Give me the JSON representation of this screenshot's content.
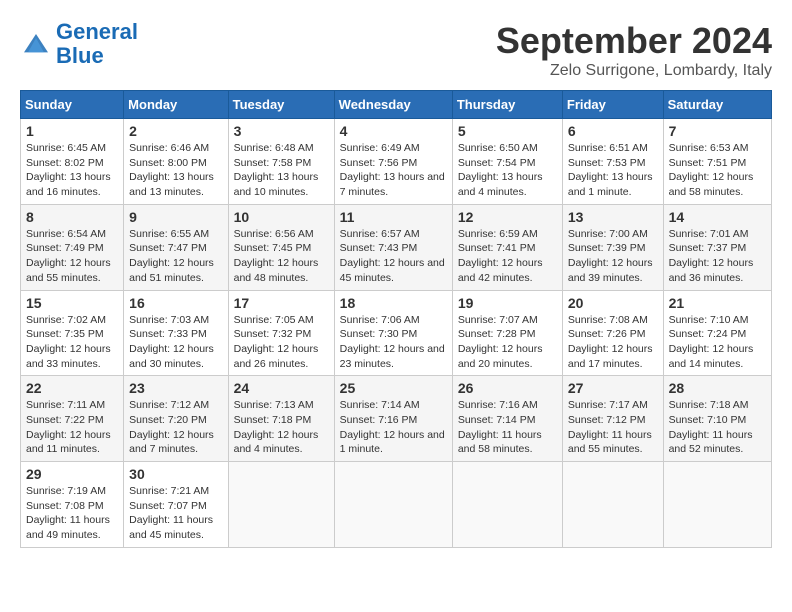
{
  "header": {
    "logo_general": "General",
    "logo_blue": "Blue",
    "title": "September 2024",
    "subtitle": "Zelo Surrigone, Lombardy, Italy"
  },
  "calendar": {
    "days_of_week": [
      "Sunday",
      "Monday",
      "Tuesday",
      "Wednesday",
      "Thursday",
      "Friday",
      "Saturday"
    ],
    "weeks": [
      [
        null,
        {
          "day": "2",
          "sunrise": "Sunrise: 6:46 AM",
          "sunset": "Sunset: 8:00 PM",
          "daylight": "Daylight: 13 hours and 13 minutes."
        },
        {
          "day": "3",
          "sunrise": "Sunrise: 6:48 AM",
          "sunset": "Sunset: 7:58 PM",
          "daylight": "Daylight: 13 hours and 10 minutes."
        },
        {
          "day": "4",
          "sunrise": "Sunrise: 6:49 AM",
          "sunset": "Sunset: 7:56 PM",
          "daylight": "Daylight: 13 hours and 7 minutes."
        },
        {
          "day": "5",
          "sunrise": "Sunrise: 6:50 AM",
          "sunset": "Sunset: 7:54 PM",
          "daylight": "Daylight: 13 hours and 4 minutes."
        },
        {
          "day": "6",
          "sunrise": "Sunrise: 6:51 AM",
          "sunset": "Sunset: 7:53 PM",
          "daylight": "Daylight: 13 hours and 1 minute."
        },
        {
          "day": "7",
          "sunrise": "Sunrise: 6:53 AM",
          "sunset": "Sunset: 7:51 PM",
          "daylight": "Daylight: 12 hours and 58 minutes."
        }
      ],
      [
        {
          "day": "1",
          "sunrise": "Sunrise: 6:45 AM",
          "sunset": "Sunset: 8:02 PM",
          "daylight": "Daylight: 13 hours and 16 minutes."
        },
        {
          "day": "9",
          "sunrise": "Sunrise: 6:55 AM",
          "sunset": "Sunset: 7:47 PM",
          "daylight": "Daylight: 12 hours and 51 minutes."
        },
        {
          "day": "10",
          "sunrise": "Sunrise: 6:56 AM",
          "sunset": "Sunset: 7:45 PM",
          "daylight": "Daylight: 12 hours and 48 minutes."
        },
        {
          "day": "11",
          "sunrise": "Sunrise: 6:57 AM",
          "sunset": "Sunset: 7:43 PM",
          "daylight": "Daylight: 12 hours and 45 minutes."
        },
        {
          "day": "12",
          "sunrise": "Sunrise: 6:59 AM",
          "sunset": "Sunset: 7:41 PM",
          "daylight": "Daylight: 12 hours and 42 minutes."
        },
        {
          "day": "13",
          "sunrise": "Sunrise: 7:00 AM",
          "sunset": "Sunset: 7:39 PM",
          "daylight": "Daylight: 12 hours and 39 minutes."
        },
        {
          "day": "14",
          "sunrise": "Sunrise: 7:01 AM",
          "sunset": "Sunset: 7:37 PM",
          "daylight": "Daylight: 12 hours and 36 minutes."
        }
      ],
      [
        {
          "day": "8",
          "sunrise": "Sunrise: 6:54 AM",
          "sunset": "Sunset: 7:49 PM",
          "daylight": "Daylight: 12 hours and 55 minutes."
        },
        {
          "day": "16",
          "sunrise": "Sunrise: 7:03 AM",
          "sunset": "Sunset: 7:33 PM",
          "daylight": "Daylight: 12 hours and 30 minutes."
        },
        {
          "day": "17",
          "sunrise": "Sunrise: 7:05 AM",
          "sunset": "Sunset: 7:32 PM",
          "daylight": "Daylight: 12 hours and 26 minutes."
        },
        {
          "day": "18",
          "sunrise": "Sunrise: 7:06 AM",
          "sunset": "Sunset: 7:30 PM",
          "daylight": "Daylight: 12 hours and 23 minutes."
        },
        {
          "day": "19",
          "sunrise": "Sunrise: 7:07 AM",
          "sunset": "Sunset: 7:28 PM",
          "daylight": "Daylight: 12 hours and 20 minutes."
        },
        {
          "day": "20",
          "sunrise": "Sunrise: 7:08 AM",
          "sunset": "Sunset: 7:26 PM",
          "daylight": "Daylight: 12 hours and 17 minutes."
        },
        {
          "day": "21",
          "sunrise": "Sunrise: 7:10 AM",
          "sunset": "Sunset: 7:24 PM",
          "daylight": "Daylight: 12 hours and 14 minutes."
        }
      ],
      [
        {
          "day": "15",
          "sunrise": "Sunrise: 7:02 AM",
          "sunset": "Sunset: 7:35 PM",
          "daylight": "Daylight: 12 hours and 33 minutes."
        },
        {
          "day": "23",
          "sunrise": "Sunrise: 7:12 AM",
          "sunset": "Sunset: 7:20 PM",
          "daylight": "Daylight: 12 hours and 7 minutes."
        },
        {
          "day": "24",
          "sunrise": "Sunrise: 7:13 AM",
          "sunset": "Sunset: 7:18 PM",
          "daylight": "Daylight: 12 hours and 4 minutes."
        },
        {
          "day": "25",
          "sunrise": "Sunrise: 7:14 AM",
          "sunset": "Sunset: 7:16 PM",
          "daylight": "Daylight: 12 hours and 1 minute."
        },
        {
          "day": "26",
          "sunrise": "Sunrise: 7:16 AM",
          "sunset": "Sunset: 7:14 PM",
          "daylight": "Daylight: 11 hours and 58 minutes."
        },
        {
          "day": "27",
          "sunrise": "Sunrise: 7:17 AM",
          "sunset": "Sunset: 7:12 PM",
          "daylight": "Daylight: 11 hours and 55 minutes."
        },
        {
          "day": "28",
          "sunrise": "Sunrise: 7:18 AM",
          "sunset": "Sunset: 7:10 PM",
          "daylight": "Daylight: 11 hours and 52 minutes."
        }
      ],
      [
        {
          "day": "22",
          "sunrise": "Sunrise: 7:11 AM",
          "sunset": "Sunset: 7:22 PM",
          "daylight": "Daylight: 12 hours and 11 minutes."
        },
        {
          "day": "30",
          "sunrise": "Sunrise: 7:21 AM",
          "sunset": "Sunset: 7:07 PM",
          "daylight": "Daylight: 11 hours and 45 minutes."
        },
        null,
        null,
        null,
        null,
        null
      ],
      [
        {
          "day": "29",
          "sunrise": "Sunrise: 7:19 AM",
          "sunset": "Sunset: 7:08 PM",
          "daylight": "Daylight: 11 hours and 49 minutes."
        },
        null,
        null,
        null,
        null,
        null,
        null
      ]
    ]
  }
}
